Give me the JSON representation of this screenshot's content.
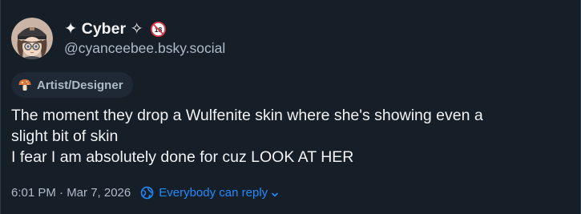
{
  "author": {
    "display_name": "✦ Cyber ✧",
    "handle": "@cyanceebee.bsky.social",
    "avatar_icon": "avatar-illustration",
    "label_icon": "no-under-18-icon"
  },
  "badge": {
    "label": "Artist/Designer",
    "icon": "mushroom-icon"
  },
  "post": {
    "lines": [
      "The moment they drop a Wulfenite skin where she's showing even a",
      "slight bit of skin",
      "I fear I am absolutely done for cuz LOOK AT HER"
    ]
  },
  "meta": {
    "timestamp": "6:01 PM · Mar 7, 2026",
    "reply_setting": "Everybody can reply",
    "reply_icon": "earth-icon",
    "accent": "#208bfe"
  }
}
